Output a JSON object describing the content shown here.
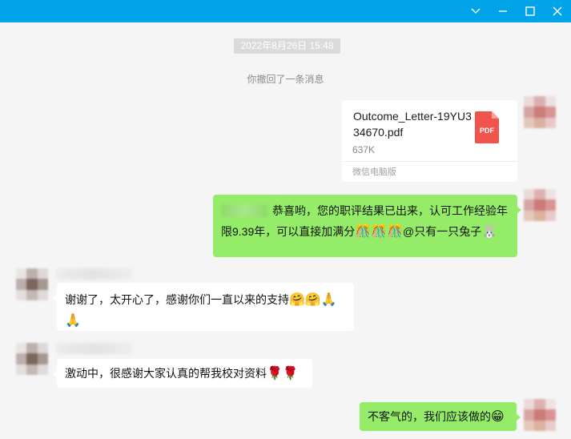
{
  "window": {
    "controls": [
      "chevron-down-icon",
      "minimize-icon",
      "maximize-icon",
      "close-icon"
    ]
  },
  "chat": {
    "timestamp": "2022年8月26日 15:48",
    "recall_notice": "你撤回了一条消息",
    "file_message": {
      "filename": "Outcome_Letter-19YU334670.pdf",
      "size": "637K",
      "source": "微信电脑版",
      "icon_label": "PDF"
    },
    "messages": [
      {
        "side": "right",
        "text": "恭喜哟，您的职评结果已出来，认可工作经验年限9.39年，可以直接加满分",
        "emoji": "🎊🎊🎊",
        "mention": "@只有一只兔子",
        "mention_emoji": "🐰"
      },
      {
        "side": "left",
        "text": "谢谢了，太开心了，感谢你们一直以来的支持",
        "emoji": "🤗🤗🙏🙏"
      },
      {
        "side": "left",
        "text": "激动中，很感谢大家认真的帮我校对资料",
        "emoji": "🌹🌹"
      },
      {
        "side": "right",
        "text": "不客气的，我们应该做的",
        "emoji": "😁"
      }
    ]
  },
  "colors": {
    "titlebar": "#00a2e8",
    "background": "#f5f5f5",
    "bubble_self": "#95ec69",
    "bubble_other": "#ffffff",
    "pdf_icon": "#f0544d"
  }
}
